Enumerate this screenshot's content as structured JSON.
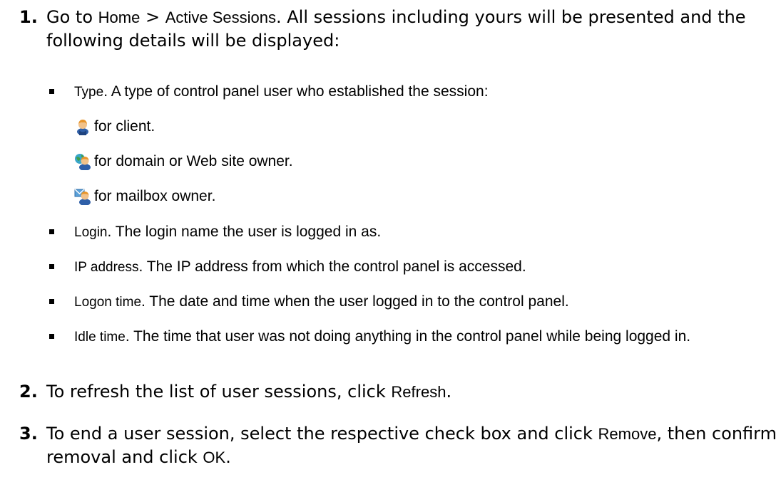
{
  "steps": [
    {
      "num": "1.",
      "pre": "Go to ",
      "ui1": "Home",
      "sep": " > ",
      "ui2": "Active Sessions",
      "post": ". All sessions including yours will be presented and the following details will be displayed:"
    },
    {
      "num": "2.",
      "pre": "To refresh the list of user sessions, click ",
      "ui1": "Refresh",
      "post": "."
    },
    {
      "num": "3.",
      "pre": "To end a user session, select the respective check box and click ",
      "ui1": "Remove",
      "mid": ", then confirm removal and click ",
      "ui2": "OK",
      "post": "."
    }
  ],
  "details": [
    {
      "term": "Type",
      "text": ". A type of control panel user who established the session:"
    },
    {
      "term": "Login",
      "text": ". The login name the user is logged in as."
    },
    {
      "term": "IP address",
      "text": ". The IP address from which the control panel is accessed."
    },
    {
      "term": "Logon time",
      "text": ". The date and time when the user logged in to the control panel."
    },
    {
      "term": "Idle time",
      "text": ". The time that user was not doing anything in the control panel while being logged in."
    }
  ],
  "user_types": [
    {
      "icon": "client-user-icon",
      "label": "for client."
    },
    {
      "icon": "domain-owner-icon",
      "label": "for domain or Web site owner."
    },
    {
      "icon": "mailbox-owner-icon",
      "label": "for mailbox owner."
    }
  ],
  "colors": {
    "text": "#000000",
    "background": "#ffffff",
    "icon_person_orange": "#e8952a",
    "icon_person_blue": "#2f5fa8",
    "icon_globe_teal": "#3aa6c9",
    "icon_envelope": "#5aa0d8"
  }
}
